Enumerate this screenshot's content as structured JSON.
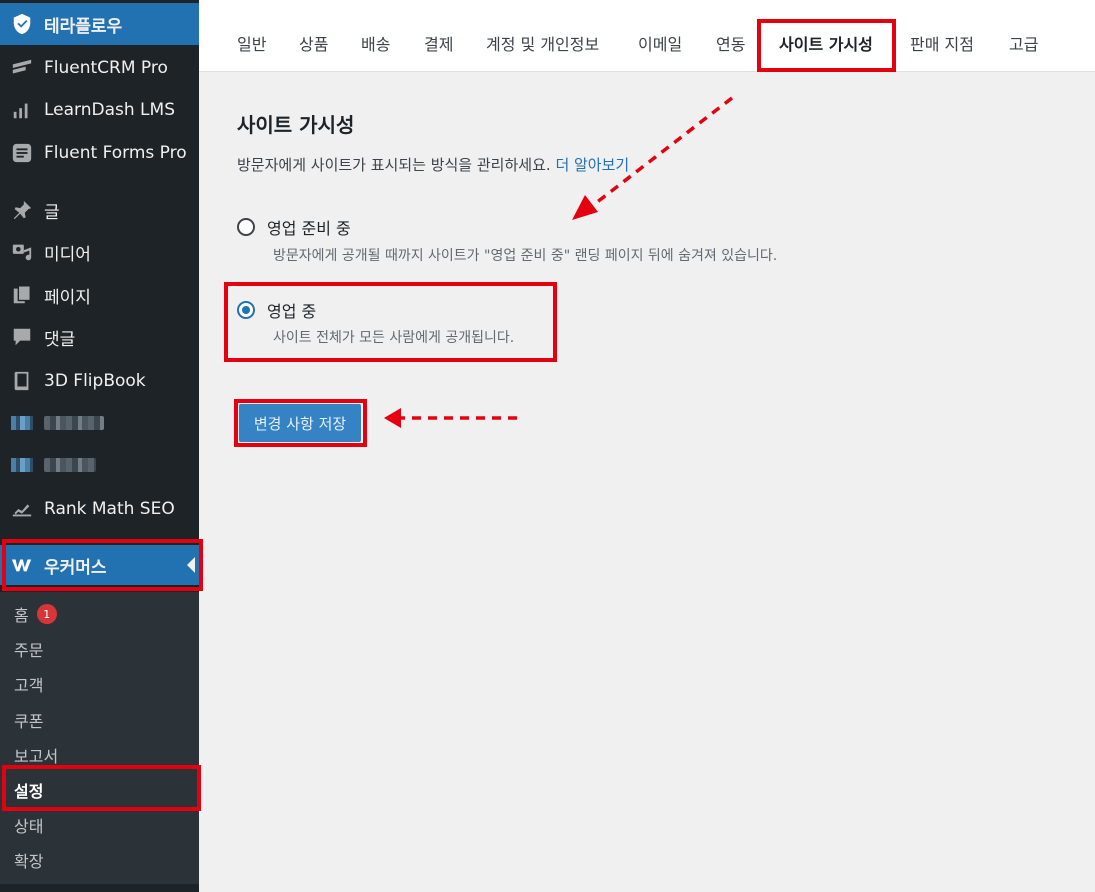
{
  "sidebar": {
    "brand": {
      "label": "테라플로우",
      "icon": "shield-icon"
    },
    "items": [
      {
        "label": "FluentCRM Pro",
        "icon": "fluentcrm-icon"
      },
      {
        "label": "LearnDash LMS",
        "icon": "learndash-icon"
      },
      {
        "label": "Fluent Forms Pro",
        "icon": "fluentforms-icon"
      },
      {
        "label": "글",
        "icon": "pin-icon"
      },
      {
        "label": "미디어",
        "icon": "media-icon"
      },
      {
        "label": "페이지",
        "icon": "pages-icon"
      },
      {
        "label": "댓글",
        "icon": "comment-icon"
      },
      {
        "label": "3D FlipBook",
        "icon": "book-icon"
      },
      {
        "label": "Rank Math SEO",
        "icon": "rankmath-icon"
      }
    ],
    "woocommerce": {
      "label": "우커머스",
      "icon": "woocommerce-icon"
    },
    "submenu": [
      {
        "label": "홈",
        "badge": "1"
      },
      {
        "label": "주문"
      },
      {
        "label": "고객"
      },
      {
        "label": "쿠폰"
      },
      {
        "label": "보고서"
      },
      {
        "label": "설정",
        "current": true
      },
      {
        "label": "상태"
      },
      {
        "label": "확장"
      }
    ]
  },
  "tabs": [
    {
      "label": "일반"
    },
    {
      "label": "상품"
    },
    {
      "label": "배송"
    },
    {
      "label": "결제"
    },
    {
      "label": "계정 및 개인정보"
    },
    {
      "label": "이메일"
    },
    {
      "label": "연동"
    },
    {
      "label": "사이트 가시성",
      "active": true
    },
    {
      "label": "판매 지점"
    },
    {
      "label": "고급"
    }
  ],
  "main": {
    "title": "사이트 가시성",
    "description": "방문자에게 사이트가 표시되는 방식을 관리하세요.",
    "learn_more": "더 알아보기",
    "options": [
      {
        "label": "영업 준비 중",
        "help": "방문자에게 공개될 때까지 사이트가 \"영업 준비 중\" 랜딩 페이지 뒤에 숨겨져 있습니다.",
        "checked": false
      },
      {
        "label": "영업 중",
        "help": "사이트 전체가 모든 사람에게 공개됩니다.",
        "checked": true
      }
    ],
    "save_label": "변경 사항 저장"
  },
  "colors": {
    "sidebar_bg": "#1d2327",
    "accent": "#2271b1",
    "highlight": "#e4000e",
    "badge": "#d63638"
  }
}
